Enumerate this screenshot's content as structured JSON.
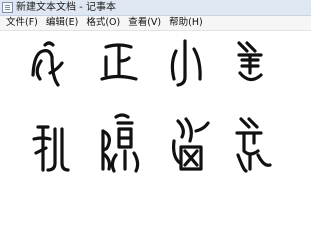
{
  "window": {
    "title": "新建文本文档 - 记事本",
    "icon": "notepad-icon"
  },
  "menubar": {
    "items": [
      {
        "label": "文件(F)"
      },
      {
        "label": "编辑(E)"
      },
      {
        "label": "格式(O)"
      },
      {
        "label": "查看(V)"
      },
      {
        "label": "帮助(H)"
      }
    ]
  },
  "editor": {
    "content_description_glyphs": [
      "seal-char-1",
      "seal-char-2",
      "seal-char-3",
      "seal-char-4",
      "seal-char-5",
      "seal-char-6",
      "seal-char-7",
      "seal-char-8"
    ]
  }
}
